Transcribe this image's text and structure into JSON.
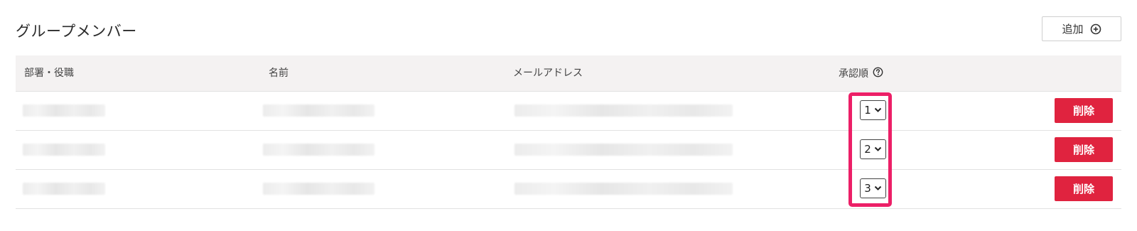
{
  "page": {
    "title": "グループメンバー",
    "add_button_label": "追加"
  },
  "table": {
    "headers": {
      "department": "部署・役職",
      "name": "名前",
      "email": "メールアドレス",
      "approval_order": "承認順"
    },
    "rows": [
      {
        "order": "1",
        "delete_label": "削除"
      },
      {
        "order": "2",
        "delete_label": "削除"
      },
      {
        "order": "3",
        "delete_label": "削除"
      }
    ]
  },
  "icons": {
    "add": "plus-circle-icon",
    "help": "question-circle-icon",
    "select": "chevron-down-icon"
  },
  "colors": {
    "delete_button": "#e0233f",
    "highlight": "#ec1f67",
    "header_background": "#f4f2f2"
  }
}
